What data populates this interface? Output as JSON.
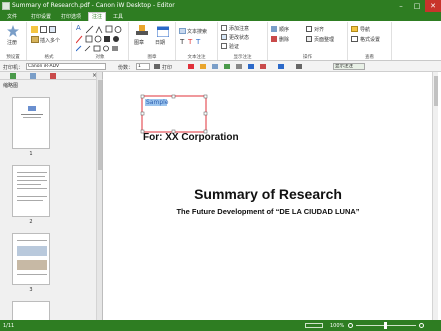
{
  "window": {
    "title": "Summary of Research.pdf - Canon iW Desktop - Editor",
    "minimize": "–",
    "maximize": "□",
    "close": "✕"
  },
  "tabs": [
    {
      "label": "文件"
    },
    {
      "label": "打印设置"
    },
    {
      "label": "打印选项"
    },
    {
      "label": "注注"
    },
    {
      "label": "工具"
    }
  ],
  "ribbon": {
    "groups": {
      "settings": "预设置",
      "format": "格式",
      "objects": "对象",
      "stamp": "图章",
      "text_annotation": "文本注注",
      "display_annotation": "显示注注",
      "operation": "操作",
      "view": "查看"
    },
    "register_label": "注册",
    "insert_multiple": "插入多个",
    "stamp_label": "图章",
    "date_label": "日期",
    "text_search": "文本搜索",
    "show_annotation": "添加注意",
    "annotation_state": "更改状态",
    "verify": "验证",
    "order": "顺序",
    "alignment": "对齐",
    "delete": "删除",
    "page_setup": "页面整理",
    "navigate": "导航",
    "properties": "格式设置"
  },
  "toolbar": {
    "printer_label": "打印机：",
    "printer_value": "Canon iR-ADV",
    "copies_label": "份数：",
    "copies_value": "1",
    "print_label": "打印",
    "display_annotation_btn": "显示注注"
  },
  "sidepanel": {
    "tab_label": "缩略图",
    "pages": [
      "1",
      "2",
      "3"
    ]
  },
  "document": {
    "annotation_text": "Sample",
    "corporation": "For: XX Corporation",
    "title": "Summary of Research",
    "subtitle": "The Future Development of “DE LA CIUDAD LUNA”"
  },
  "status": {
    "page_info": "1/11",
    "zoom": "100%"
  },
  "colors": {
    "brand_green": "#2e7d22",
    "annotation_red": "#e0303a",
    "selection_blue": "#9cc5ee"
  }
}
